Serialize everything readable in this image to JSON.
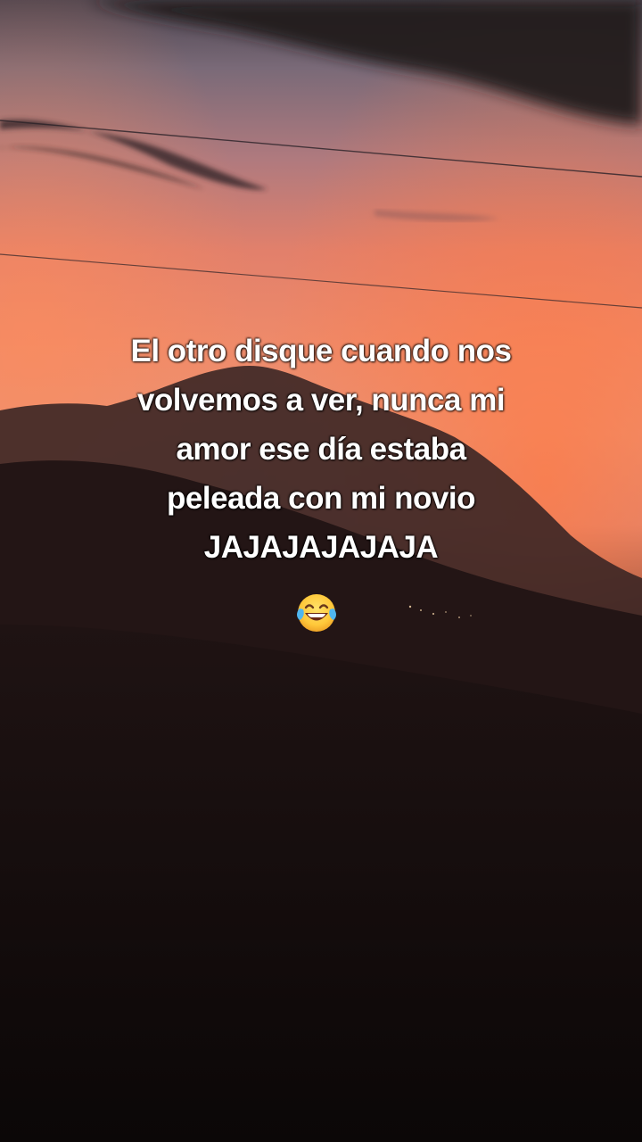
{
  "caption": {
    "lines": [
      "El otro disque cuando nos",
      "volvemos a ver, nunca mi",
      "amor ese día estaba",
      "peleada con mi novio",
      "JAJAJAJAJAJA"
    ]
  },
  "emoji": {
    "icon": "face-with-tears-of-joy-icon"
  },
  "scene": {
    "subject": "sunset sky over mountain silhouette",
    "colors": {
      "sky_top": "#5a4a55",
      "sky_glow": "#e8734f",
      "horizon": "#f39062",
      "ground": "#0e0909"
    }
  }
}
